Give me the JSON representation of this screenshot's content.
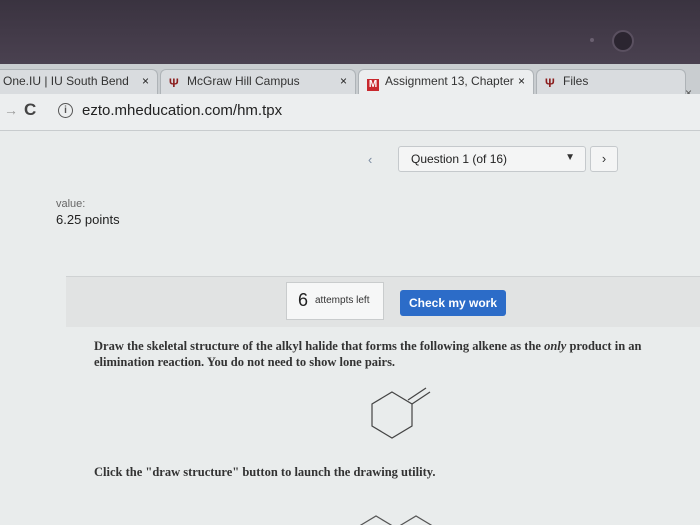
{
  "tabs": [
    {
      "label": "One.IU | IU South Bend",
      "favicon": "none",
      "close": "×"
    },
    {
      "label": "McGraw Hill Campus",
      "favicon": "iu-trident-icon",
      "close": "×"
    },
    {
      "label": "Assignment 13, Chapter",
      "favicon": "m-logo-icon",
      "close": "×"
    },
    {
      "label": "Files",
      "favicon": "iu-trident-icon",
      "close": ""
    }
  ],
  "window_close": "×",
  "address": {
    "url": "ezto.mheducation.com/hm.tpx"
  },
  "question_nav": {
    "current": "Question 1 (of 16)",
    "prev_glyph": "‹",
    "next_glyph": "›"
  },
  "value": {
    "label": "value:",
    "points": "6.25 points"
  },
  "attempts": {
    "count": "6",
    "label": "attempts left"
  },
  "check_button": {
    "label": "Check my work"
  },
  "question": {
    "line1_pre": "Draw the skeletal structure of the alkyl halide that forms the following alkene as the ",
    "emphasis": "only",
    "line1_post": " product in an elimination reaction. You do not need to show lone pairs."
  },
  "instruction": "Click the \"draw structure\" button to launch the drawing utility.",
  "colors": {
    "accent": "#2c6cc8",
    "tab_active": "#eceeef",
    "page_bg": "#e9ecec"
  }
}
